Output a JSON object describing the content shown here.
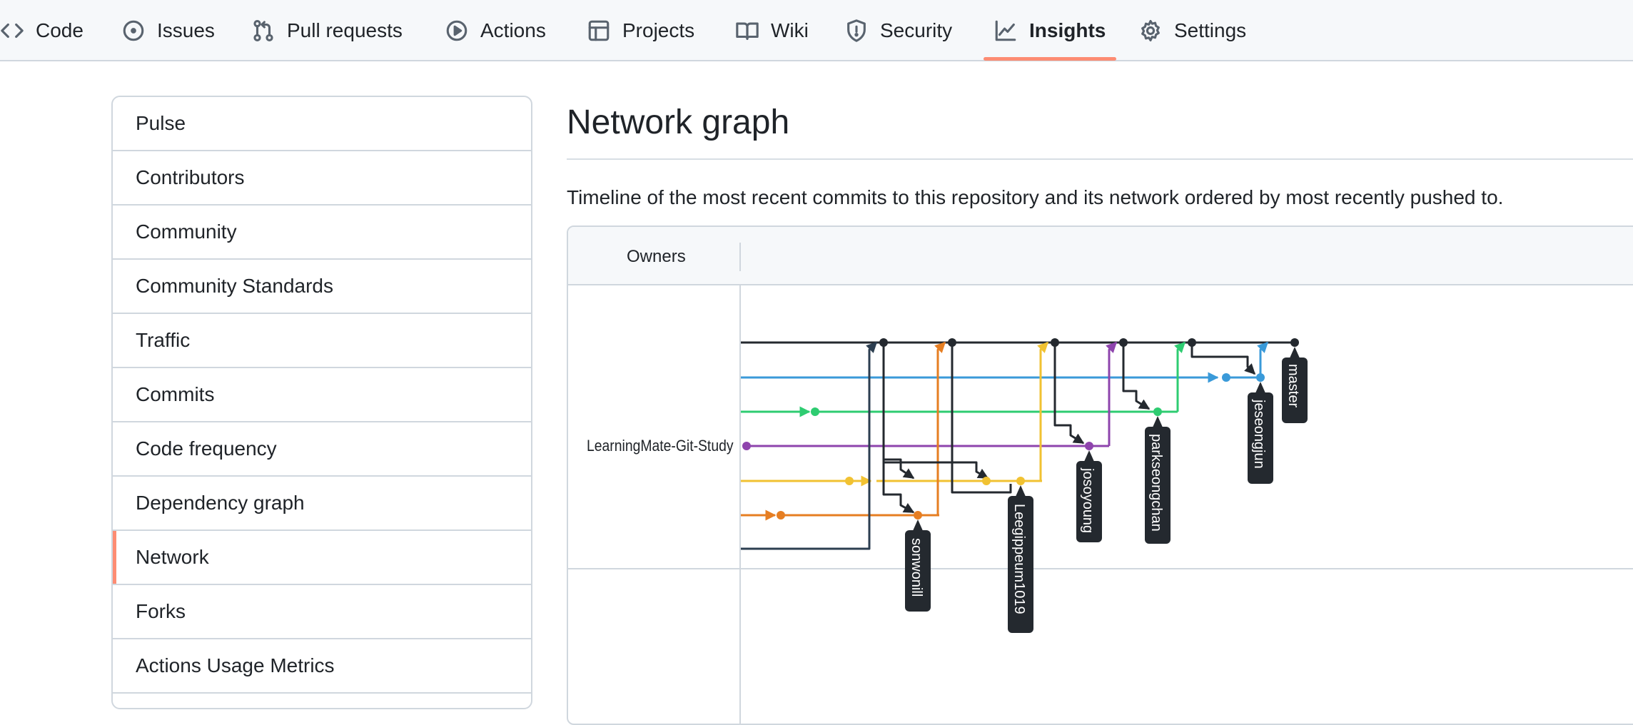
{
  "nav": {
    "tabs": [
      {
        "label": "Code",
        "icon": "code-icon"
      },
      {
        "label": "Issues",
        "icon": "issue-opened-icon"
      },
      {
        "label": "Pull requests",
        "icon": "git-pull-request-icon"
      },
      {
        "label": "Actions",
        "icon": "play-icon"
      },
      {
        "label": "Projects",
        "icon": "table-icon"
      },
      {
        "label": "Wiki",
        "icon": "book-icon"
      },
      {
        "label": "Security",
        "icon": "shield-icon"
      },
      {
        "label": "Insights",
        "icon": "graph-icon",
        "active": true
      },
      {
        "label": "Settings",
        "icon": "gear-icon"
      }
    ],
    "active_color": "#fd8c73"
  },
  "sidebar": {
    "items": [
      {
        "label": "Pulse"
      },
      {
        "label": "Contributors"
      },
      {
        "label": "Community"
      },
      {
        "label": "Community Standards"
      },
      {
        "label": "Traffic"
      },
      {
        "label": "Commits"
      },
      {
        "label": "Code frequency"
      },
      {
        "label": "Dependency graph"
      },
      {
        "label": "Network",
        "selected": true
      },
      {
        "label": "Forks"
      },
      {
        "label": "Actions Usage Metrics"
      }
    ]
  },
  "main": {
    "title": "Network graph",
    "description": "Timeline of the most recent commits to this repository and its network ordered by most recently pushed to.",
    "owners_header": "Owners",
    "owner_name": "LearningMate-Git-Study"
  },
  "network": {
    "branches": [
      {
        "name": "master",
        "color": "#24292f"
      },
      {
        "name": "jeseongjun",
        "color": "#3a9ad9"
      },
      {
        "name": "parkseongchan",
        "color": "#2ecc71"
      },
      {
        "name": "josoyoung",
        "color": "#8e44ad"
      },
      {
        "name": "Leegippeum1019",
        "color": "#f1c232"
      },
      {
        "name": "sonwonill",
        "color": "#e67e22"
      }
    ],
    "label_bg": "#24292f"
  }
}
